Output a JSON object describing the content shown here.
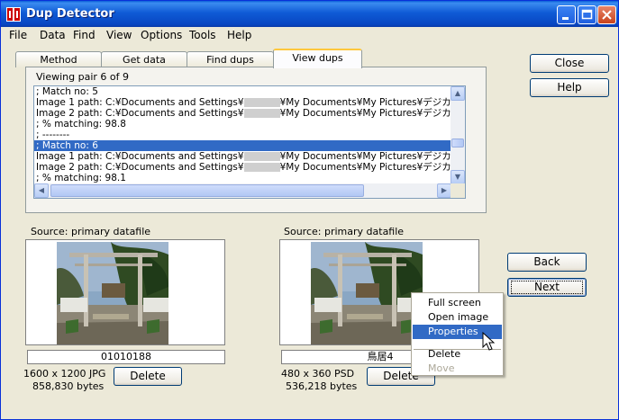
{
  "window": {
    "title": "Dup Detector"
  },
  "menu": [
    "File",
    "Data",
    "Find",
    "View",
    "Options",
    "Tools",
    "Help"
  ],
  "tabs": [
    "Method",
    "Get data",
    "Find dups",
    "View dups"
  ],
  "viewing": "Viewing pair 6 of 9",
  "list_lines": [
    "; Match no: 5",
    "Image 1 path: C:¥Documents and Settings¥",
    "Image 2 path: C:¥Documents and Settings¥",
    "; % matching: 98.8",
    "; --------",
    "; Match no: 6",
    "Image 1 path: C:¥Documents and Settings¥",
    "Image 2 path: C:¥Documents and Settings¥",
    "; % matching: 98.1"
  ],
  "list_path_suffix": "¥My Documents¥My Pictures¥デジカメ¥l",
  "right_buttons": {
    "close": "Close",
    "help": "Help",
    "back": "Back",
    "next": "Next"
  },
  "left_image": {
    "source": "Source: primary datafile",
    "caption": "01010188",
    "dims": "1600 x 1200 JPG",
    "bytes": "858,830 bytes",
    "delete": "Delete"
  },
  "right_image": {
    "source": "Source: primary datafile",
    "caption": "鳥居4",
    "dims": "480 x 360 PSD",
    "bytes": "536,218 bytes",
    "delete": "Delete"
  },
  "context_menu": [
    "Full screen",
    "Open image",
    "Properties",
    "Delete",
    "Move"
  ],
  "colors": {
    "title_bar": "#0a5fd8",
    "selection": "#316ac5",
    "window_bg": "#ece9d8"
  }
}
